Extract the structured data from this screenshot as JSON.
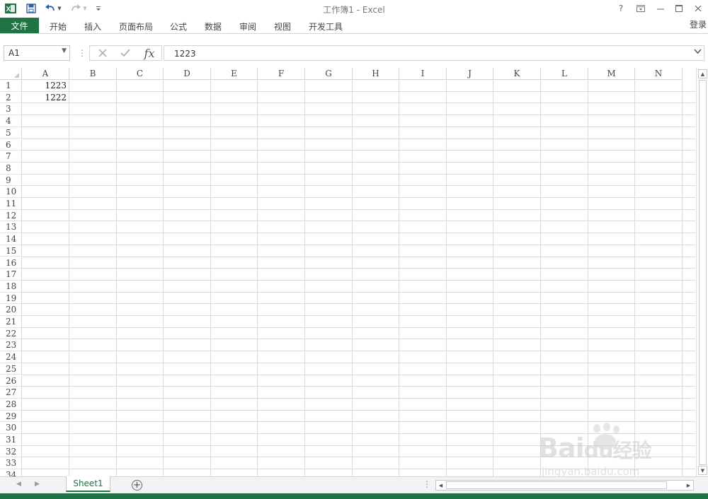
{
  "window": {
    "title": "工作簿1 - Excel",
    "help": "?",
    "restore_ribbon": "⧉",
    "minimize": "—",
    "maximize": "☐",
    "close": "✕"
  },
  "quick_access": {
    "app_icon": "excel-logo-icon",
    "save": "save-icon",
    "undo": "undo-icon",
    "redo": "redo-icon",
    "customize": "customize-icon"
  },
  "ribbon": {
    "file_tab": "文件",
    "tabs": [
      "开始",
      "插入",
      "页面布局",
      "公式",
      "数据",
      "审阅",
      "视图",
      "开发工具"
    ],
    "login": "登录"
  },
  "formula_bar": {
    "name_box": "A1",
    "cancel": "✕",
    "enter": "✓",
    "fx": "fx",
    "value": "1223"
  },
  "sheet": {
    "columns": [
      "A",
      "B",
      "C",
      "D",
      "E",
      "F",
      "G",
      "H",
      "I",
      "J",
      "K",
      "L",
      "M",
      "N"
    ],
    "rows": [
      "1",
      "2",
      "3",
      "4",
      "5",
      "6",
      "7",
      "8",
      "9",
      "10",
      "11",
      "12",
      "13",
      "14",
      "15",
      "16",
      "17",
      "18",
      "19",
      "20",
      "21",
      "22",
      "23",
      "24",
      "25",
      "26",
      "27",
      "28",
      "29",
      "30",
      "31",
      "32",
      "33",
      "34"
    ],
    "cells": {
      "A1": "1223",
      "A2": "1222"
    }
  },
  "tabbar": {
    "sheet_tab": "Sheet1",
    "add_sheet": "+",
    "dots": "⋮"
  },
  "watermark": {
    "logo_text": "Bai",
    "logo_text2": "经验",
    "url": "jingyan.baidu.com"
  },
  "colors": {
    "accent": "#217346",
    "grid": "#dadada"
  }
}
